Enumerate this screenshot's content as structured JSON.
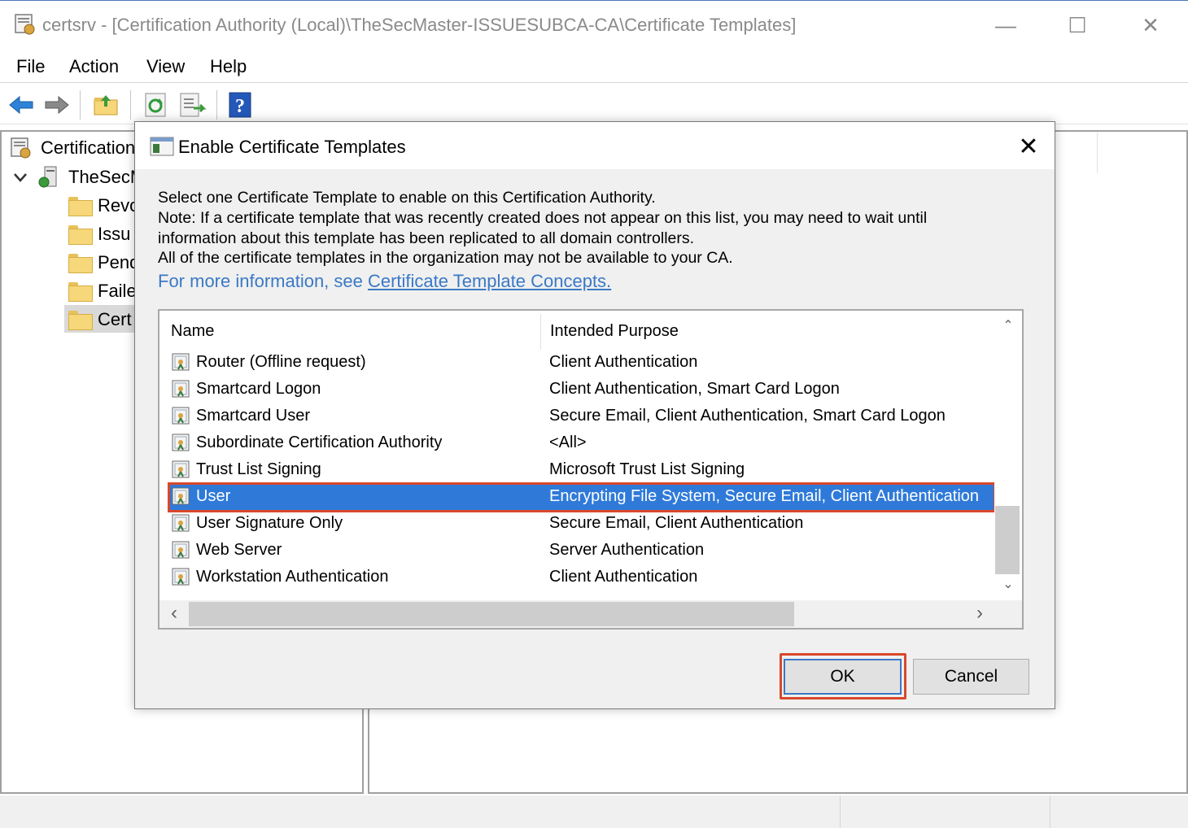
{
  "window": {
    "title": "certsrv - [Certification Authority (Local)\\TheSecMaster-ISSUESUBCA-CA\\Certificate Templates]",
    "controls": {
      "minimize": "—",
      "maximize": "☐",
      "close": "✕"
    }
  },
  "menu": [
    "File",
    "Action",
    "View",
    "Help"
  ],
  "toolbar": {
    "buttons": [
      "back-icon",
      "forward-icon",
      "up-folder-icon",
      "refresh-icon",
      "export-list-icon",
      "help-icon"
    ]
  },
  "tree": {
    "root": "Certification",
    "ca": "TheSecM",
    "folders": [
      "Revo",
      "Issu",
      "Pend",
      "Faile",
      "Cert"
    ]
  },
  "dialog": {
    "title": "Enable Certificate Templates",
    "close": "✕",
    "lines": [
      "Select one Certificate Template to enable on this Certification Authority.",
      "Note: If a certificate template that was recently created does not appear on this list, you may need to wait until",
      "information about this template has been replicated to all domain controllers.",
      "All of the certificate templates in the organization may not be available to your CA."
    ],
    "more_info_prefix": "For more information, see ",
    "more_info_link": "Certificate Template Concepts.",
    "columns": {
      "name": "Name",
      "purpose": "Intended Purpose"
    },
    "rows": [
      {
        "name": "Router (Offline request)",
        "purpose": "Client Authentication"
      },
      {
        "name": "Smartcard Logon",
        "purpose": "Client Authentication, Smart Card Logon"
      },
      {
        "name": "Smartcard User",
        "purpose": "Secure Email, Client Authentication, Smart Card Logon"
      },
      {
        "name": "Subordinate Certification Authority",
        "purpose": "<All>"
      },
      {
        "name": "Trust List Signing",
        "purpose": "Microsoft Trust List Signing"
      },
      {
        "name": "User",
        "purpose": "Encrypting File System, Secure Email, Client Authentication"
      },
      {
        "name": "User Signature Only",
        "purpose": "Secure Email, Client Authentication"
      },
      {
        "name": "Web Server",
        "purpose": "Server Authentication"
      },
      {
        "name": "Workstation Authentication",
        "purpose": "Client Authentication"
      }
    ],
    "selected_row": "User",
    "scroll_arrows": {
      "up": "⌃",
      "down": "⌄",
      "left": "‹",
      "right": "›"
    },
    "ok_label": "OK",
    "cancel_label": "Cancel"
  },
  "colors": {
    "selection": "#2f7ad9",
    "highlight": "#d9482b",
    "link": "#3a79c5"
  }
}
